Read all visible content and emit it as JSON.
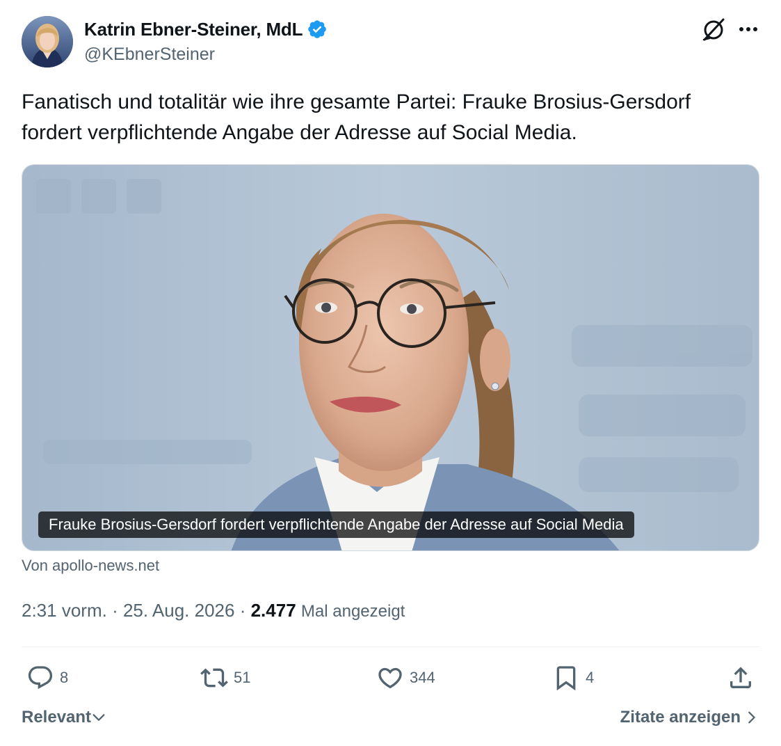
{
  "author": {
    "display_name": "Katrin Ebner-Steiner, MdL",
    "handle": "@KEbnerSteiner",
    "verified": true,
    "verified_color": "#1d9bf0"
  },
  "header_icons": [
    "grok-icon",
    "more-icon"
  ],
  "tweet": {
    "text_line1": "Fanatisch und totalitär wie ihre gesamte Partei: Frauke Brosius-Gersdorf",
    "text_line2": "fordert verpflichtende Angabe der Adresse auf Social Media."
  },
  "card": {
    "caption": "Frauke Brosius-Gersdorf fordert verpflichtende Angabe der Adresse auf Social Media",
    "source": "Von apollo-news.net"
  },
  "meta": {
    "time": "2:31 vorm.",
    "separator": "·",
    "date": "25. Aug. 2026",
    "views_count": "2.477",
    "views_label": "Mal angezeigt"
  },
  "actions": {
    "replies": "8",
    "reposts": "51",
    "likes": "344",
    "bookmarks": "4"
  },
  "footer": {
    "sort_label": "Relevant",
    "quotes_label": "Zitate anzeigen"
  },
  "colors": {
    "text_primary": "#0f1419",
    "text_secondary": "#536471",
    "border": "#cfd9de"
  }
}
